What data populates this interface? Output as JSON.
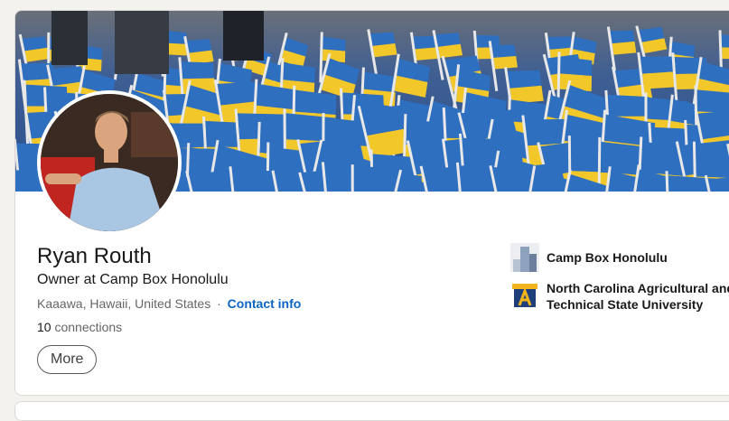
{
  "profile": {
    "name": "Ryan Routh",
    "headline": "Owner at Camp Box Honolulu",
    "location": "Kaaawa, Hawaii, United States",
    "separator": "·",
    "contact_label": "Contact info",
    "connections_count": "10",
    "connections_label": "connections",
    "more_label": "More"
  },
  "affiliations": [
    {
      "name": "Camp Box Honolulu",
      "logo": "company-logo-icon"
    },
    {
      "name": "North Carolina Agricultural and Technical State University",
      "logo": "university-logo-icon"
    }
  ],
  "colors": {
    "accent": "#0a66c2",
    "flag_blue": "#2f6fc0",
    "flag_yellow": "#f2c72a"
  }
}
